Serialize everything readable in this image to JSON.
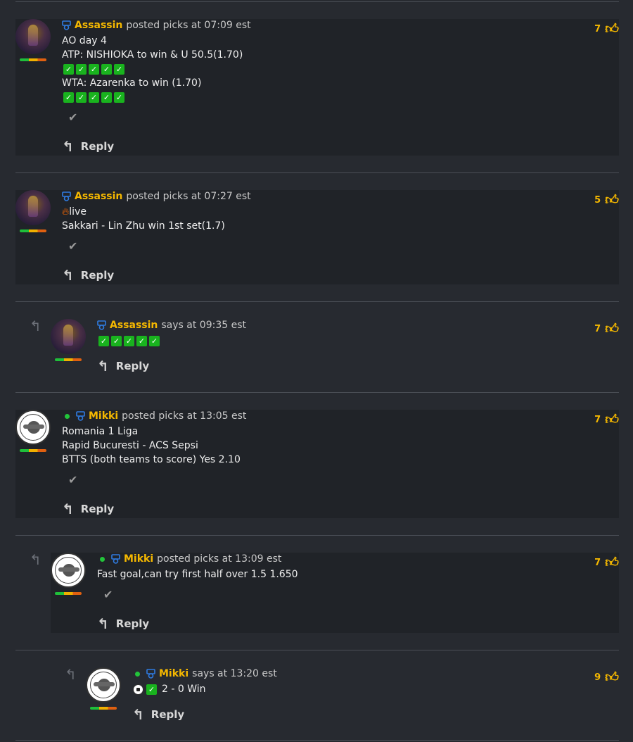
{
  "colors": {
    "username": "#f5b800",
    "check_green": "#19b31e",
    "online": "#22c43a",
    "badge_blue": "#2f7be0"
  },
  "comments": [
    {
      "username": "Assassin",
      "meta": "posted picks at 07:09 est",
      "lines": [
        "AO day 4",
        "ATP: NISHIOKA to win & U 50.5(1.70)",
        "WTA: Azarenka to win (1.70)"
      ],
      "likes": "7",
      "reply": "Reply"
    },
    {
      "username": "Assassin",
      "meta": "posted picks at 07:27 est",
      "lines": [
        "live",
        "Sakkari - Lin Zhu win 1st set(1.7)"
      ],
      "likes": "5",
      "reply": "Reply"
    },
    {
      "username": "Assassin",
      "meta": "says at 09:35 est",
      "lines": [],
      "likes": "7",
      "reply": "Reply"
    },
    {
      "username": "Mikki",
      "meta": "posted picks at 13:05 est",
      "lines": [
        "Romania 1 Liga",
        "Rapid Bucuresti - ACS Sepsi",
        "BTTS (both teams to score) Yes 2.10"
      ],
      "likes": "7",
      "reply": "Reply"
    },
    {
      "username": "Mikki",
      "meta": "posted picks at 13:09 est",
      "lines": [
        "Fast goal,can try first half over 1.5 1.650"
      ],
      "likes": "7",
      "reply": "Reply"
    },
    {
      "username": "Mikki",
      "meta": "says at 13:20 est",
      "lines": [
        "2 - 0 Win"
      ],
      "likes": "9",
      "reply": "Reply"
    }
  ],
  "icons": {
    "check": "check-icon",
    "thumb": "thumbs-up-icon",
    "reply": "reply-icon",
    "badge": "rank-badge-icon",
    "fire": "fire-icon",
    "soccer": "soccer-ball-icon",
    "nested": "nested-reply-arrow-icon"
  }
}
